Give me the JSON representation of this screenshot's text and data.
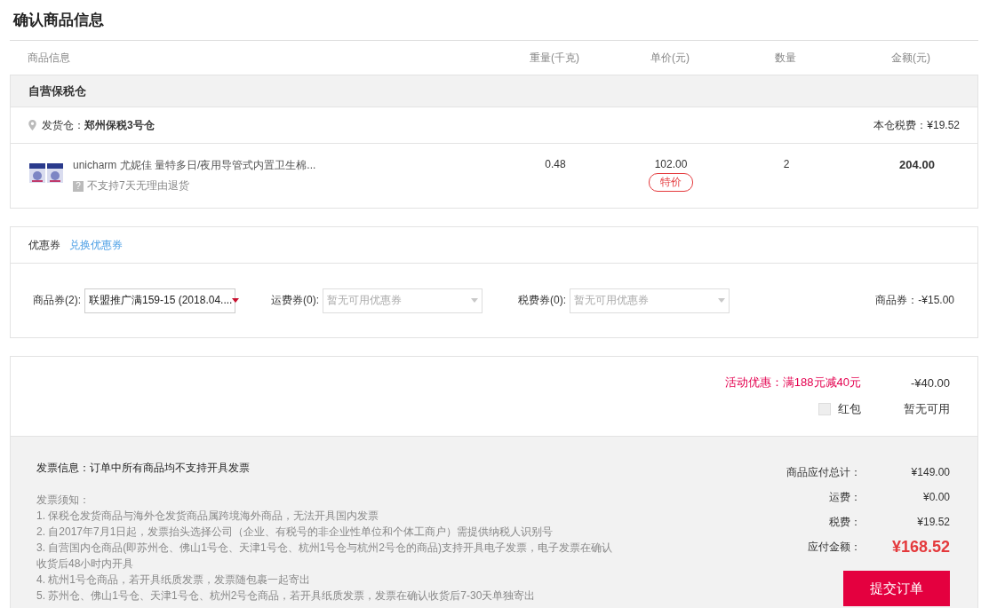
{
  "title": "确认商品信息",
  "columns": [
    "商品信息",
    "重量(千克)",
    "单价(元)",
    "数量",
    "金额(元)"
  ],
  "warehouse": {
    "name": "自营保税仓",
    "ship_from_label": "发货仓：",
    "ship_from": "郑州保税3号仓",
    "tax": "本仓税费：¥19.52"
  },
  "items": [
    {
      "kind": "picture",
      "name": "unicharm 尤妮佳 量特多日/夜用导管式内置卫生棉...",
      "note_icon": "?",
      "note": "不支持7天无理由退货",
      "weight": "0.48",
      "price": "102.00",
      "tag": "特价",
      "quantity": "2",
      "amount": "204.00"
    }
  ],
  "coupons": {
    "title": "优惠券",
    "link": "兑换优惠券",
    "selects": [
      {
        "label": "商品券(2):",
        "value": "联盟推广满159-15 (2018.04....",
        "disabled": false
      },
      {
        "label": "运费券(0):",
        "placeholder": "暂无可用优惠券",
        "disabled": true
      },
      {
        "label": "税费券(0):",
        "placeholder": "暂无可用优惠券",
        "disabled": true
      }
    ],
    "summary": "商品券：-¥15.00"
  },
  "promotion": {
    "label": "活动优惠：满188元减40元",
    "value": "-¥40.00"
  },
  "bonus_packet": {
    "label": "红包",
    "checked": false,
    "value": "暂无可用"
  },
  "invoice": {
    "info": "发票信息：订单中所有商品均不支持开具发票",
    "notice_title": "发票须知：",
    "notices": [
      "1. 保税仓发货商品与海外仓发货商品属跨境海外商品，无法开具国内发票",
      "2. 自2017年7月1日起，发票抬头选择公司（企业、有税号的非企业性单位和个体工商户）需提供纳税人识别号",
      "3. 自营国内仓商品(即苏州仓、佛山1号仓、天津1号仓、杭州1号仓与杭州2号仓的商品)支持开具电子发票，电子发票在确认收货后48小时内开具",
      "4. 杭州1号仓商品，若开具纸质发票，发票随包裹一起寄出",
      "5. 苏州仓、佛山1号仓、天津1号仓、杭州2号仓商品，若开具纸质发票，发票在确认收货后7-30天单独寄出"
    ]
  },
  "totals": [
    {
      "kind": "row",
      "label": "商品应付总计：",
      "value": "¥149.00"
    },
    {
      "kind": "row",
      "label": "运费：",
      "value": "¥0.00"
    },
    {
      "kind": "row",
      "label": "税费：",
      "value": "¥19.52"
    },
    {
      "kind": "grand",
      "label": "应付金额：",
      "value": "¥168.52"
    }
  ],
  "submit": "提交订单"
}
